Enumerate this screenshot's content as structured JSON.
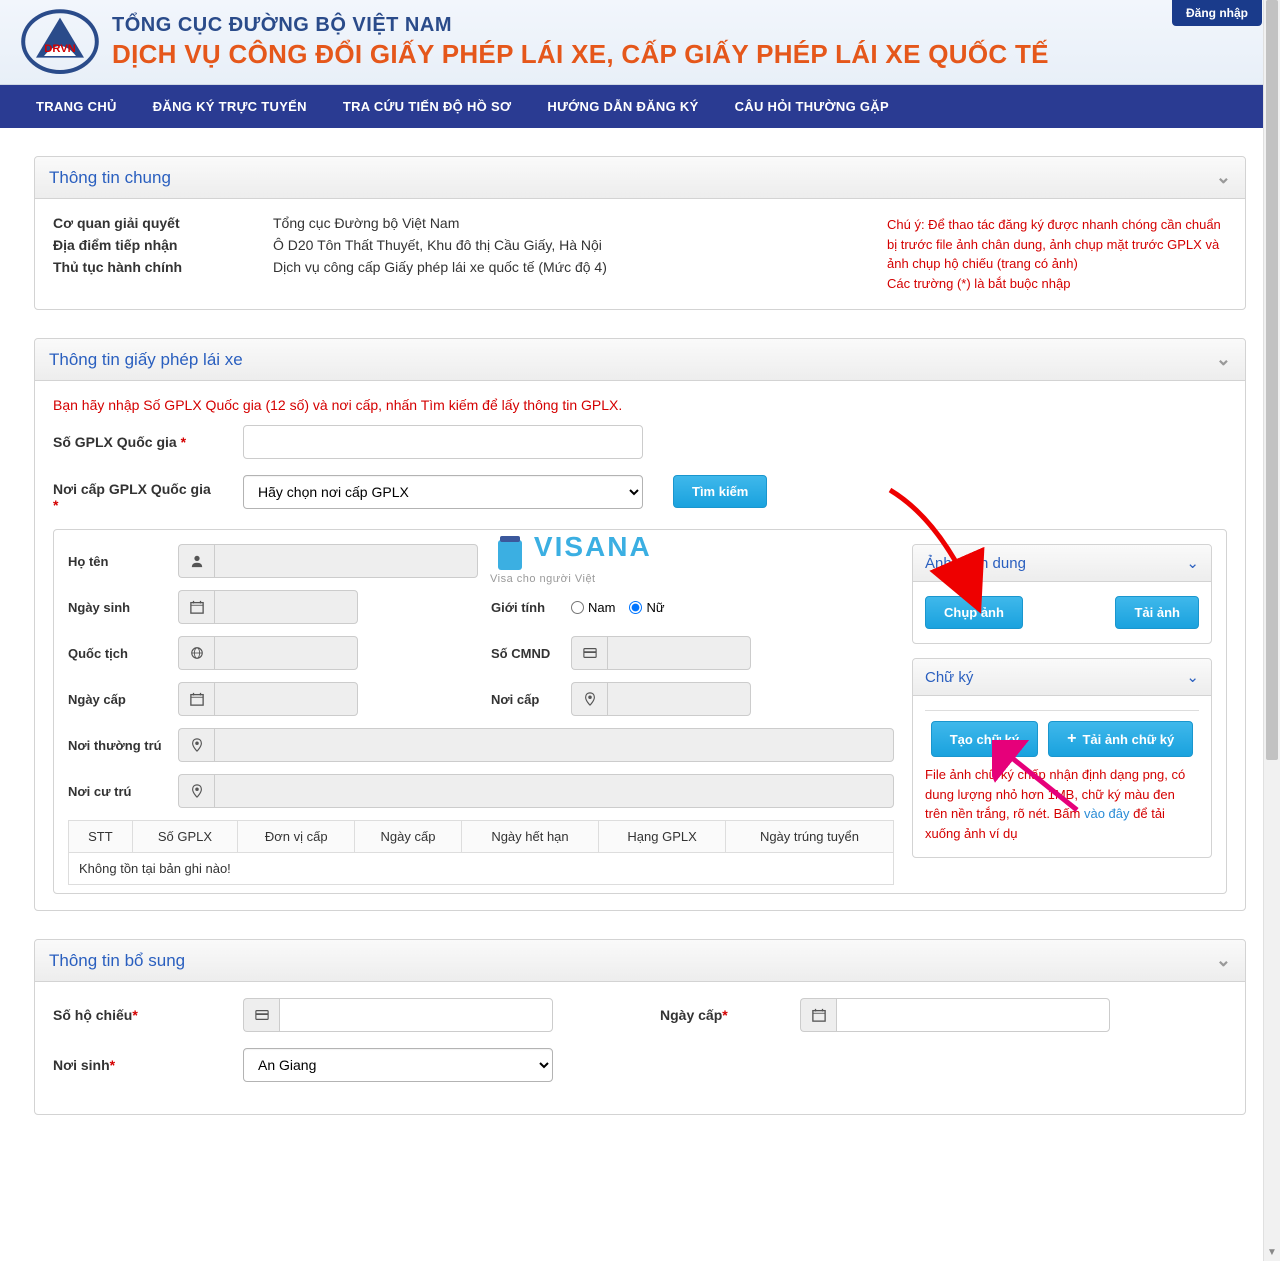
{
  "header": {
    "org": "TỔNG CỤC ĐƯỜNG BỘ VIỆT NAM",
    "service": "DỊCH VỤ CÔNG ĐỔI GIẤY PHÉP LÁI XE, CẤP GIẤY PHÉP LÁI XE QUỐC TẾ",
    "login": "Đăng nhập"
  },
  "nav": {
    "items": [
      "TRANG CHỦ",
      "ĐĂNG KÝ TRỰC TUYẾN",
      "TRA CỨU TIẾN ĐỘ HỒ SƠ",
      "HƯỚNG DẪN ĐĂNG KÝ",
      "CÂU HỎI THƯỜNG GẶP"
    ]
  },
  "panel_general": {
    "title": "Thông tin chung",
    "rows": [
      {
        "label": "Cơ quan giải quyết",
        "value": "Tổng cục Đường bộ Việt Nam"
      },
      {
        "label": "Địa điểm tiếp nhận",
        "value": "Ô D20 Tôn Thất Thuyết, Khu đô thị Cầu Giấy, Hà Nội"
      },
      {
        "label": "Thủ tục hành chính",
        "value": "Dịch vụ công cấp Giấy phép lái xe quốc tế (Mức độ 4)"
      }
    ],
    "notice1": "Chú ý: Để thao tác đăng ký được nhanh chóng cần chuẩn bị trước file ảnh chân dung, ảnh chụp mặt trước GPLX và ảnh chụp hộ chiếu (trang có ảnh)",
    "notice2": "Các trường (*) là bắt buộc nhập"
  },
  "panel_license": {
    "title": "Thông tin giấy phép lái xe",
    "instruct": "Bạn hãy nhập Số GPLX Quốc gia (12 số) và nơi cấp, nhấn Tìm kiếm để lấy thông tin GPLX.",
    "num_label": "Số GPLX Quốc gia",
    "place_label": "Nơi cấp GPLX Quốc gia",
    "place_placeholder": "Hãy chọn nơi cấp GPLX",
    "search_btn": "Tìm kiếm"
  },
  "personal": {
    "name": "Họ tên",
    "dob": "Ngày sinh",
    "gender": "Giới tính",
    "gender_m": "Nam",
    "gender_f": "Nữ",
    "nationality": "Quốc tịch",
    "idnum": "Số CMND",
    "issue_date": "Ngày cấp",
    "issue_place": "Nơi cấp",
    "perm_addr": "Nơi thường trú",
    "curr_addr": "Nơi cư trú"
  },
  "photo_panel": {
    "title": "Ảnh chân dung",
    "capture": "Chụp ảnh",
    "upload": "Tải ảnh"
  },
  "sig_panel": {
    "title": "Chữ ký",
    "create": "Tạo chữ ký",
    "upload": "Tải ảnh chữ ký",
    "note_pre": "File ảnh chữ ký chấp nhận định dạng png, có dung lượng nhỏ hơn 1MB, chữ ký màu đen trên nền trắng, rõ nét. Bấm ",
    "note_link": "vào đây",
    "note_post": " để tải xuống ảnh ví dụ"
  },
  "table": {
    "headers": [
      "STT",
      "Số GPLX",
      "Đơn vị cấp",
      "Ngày cấp",
      "Ngày hết hạn",
      "Hạng GPLX",
      "Ngày trúng tuyển"
    ],
    "empty": "Không tồn tại bản ghi nào!"
  },
  "panel_extra": {
    "title": "Thông tin bổ sung",
    "passport": "Số hộ chiếu",
    "issue_date": "Ngày cấp",
    "birthplace": "Nơi sinh",
    "birthplace_val": "An Giang"
  },
  "watermark": {
    "brand": "VISANA",
    "tagline": "Visa cho người Việt"
  }
}
